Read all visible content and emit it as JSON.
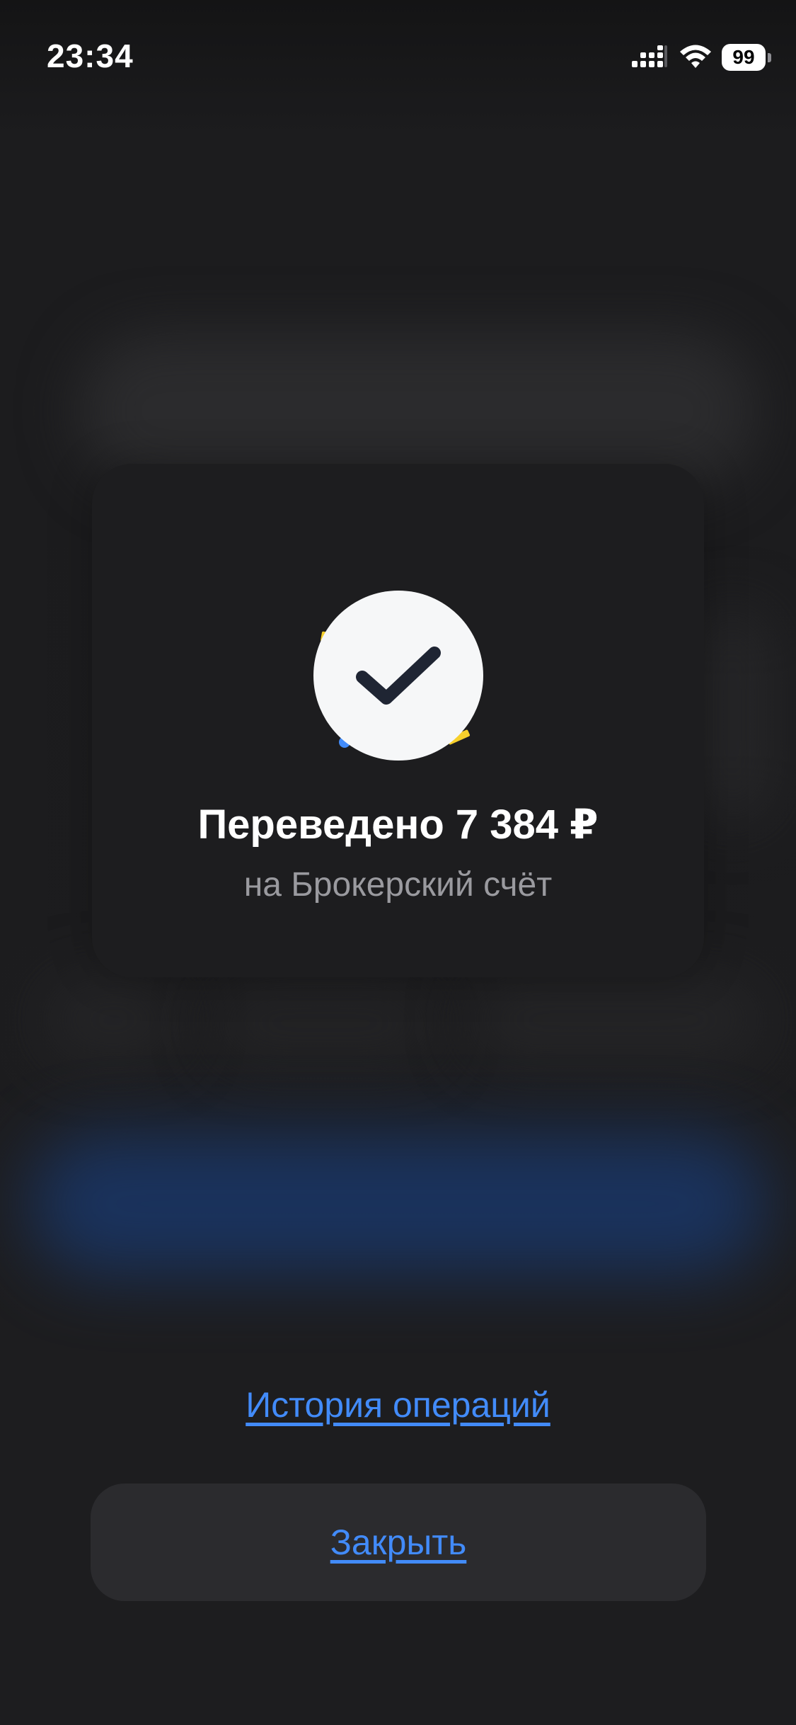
{
  "status_bar": {
    "time": "23:34",
    "battery_level": "99",
    "signal_icon": "cellular-signal-icon",
    "wifi_icon": "wifi-icon"
  },
  "success": {
    "icon": "checkmark-icon",
    "title": "Переведено 7 384 ₽",
    "subtitle": "на Брокерский счёт"
  },
  "actions": {
    "history_link": "История операций",
    "close_label": "Закрыть"
  },
  "colors": {
    "background": "#1b1b1d",
    "accent": "#428bf9",
    "confetti_yellow": "#f7d02c",
    "check_circle": "#f6f7f8",
    "check_mark": "#1f2533"
  }
}
